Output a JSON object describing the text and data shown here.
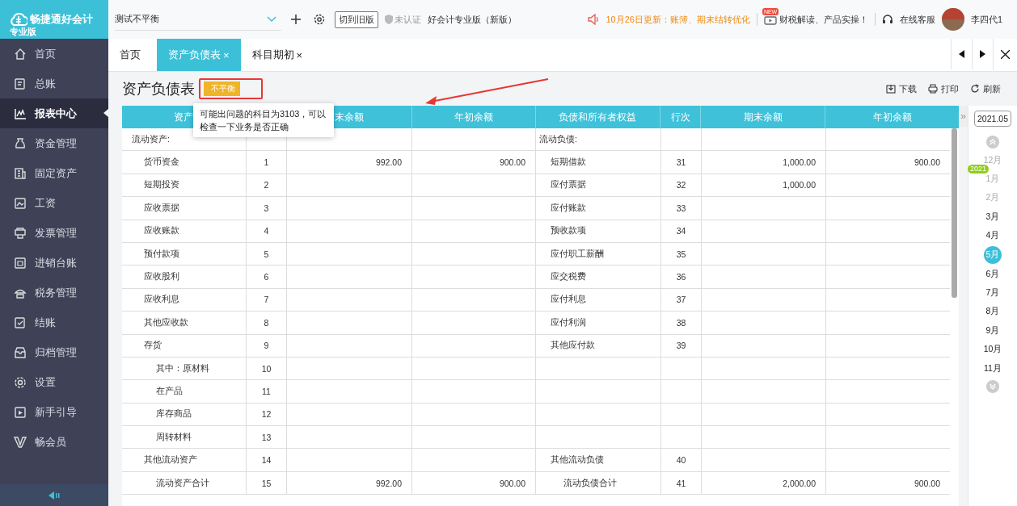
{
  "logo": {
    "name": "畅捷通好会计",
    "edition": "专业版"
  },
  "sidebar": {
    "items": [
      {
        "label": "首页",
        "selected": false
      },
      {
        "label": "总账",
        "selected": false
      },
      {
        "label": "报表中心",
        "selected": true
      },
      {
        "label": "资金管理",
        "selected": false
      },
      {
        "label": "固定资产",
        "selected": false
      },
      {
        "label": "工资",
        "selected": false
      },
      {
        "label": "发票管理",
        "selected": false
      },
      {
        "label": "进销台账",
        "selected": false
      },
      {
        "label": "税务管理",
        "selected": false
      },
      {
        "label": "结账",
        "selected": false
      },
      {
        "label": "归档管理",
        "selected": false
      },
      {
        "label": "设置",
        "selected": false
      },
      {
        "label": "新手引导",
        "selected": false
      },
      {
        "label": "畅会员",
        "selected": false
      }
    ]
  },
  "topbar": {
    "company": "测试不平衡",
    "switch_button": "切到旧版",
    "cert": "未认证",
    "product": "好会计专业版（新版）",
    "notice": "10月26日更新：账簿、期末结转优化",
    "new_badge": "NEW",
    "video": "财税解读、产品实操！",
    "service": "在线客服",
    "user": "李四代1"
  },
  "tabs": [
    {
      "label": "首页",
      "closable": false,
      "selected": false
    },
    {
      "label": "资产负债表",
      "closable": true,
      "selected": true
    },
    {
      "label": "科目期初",
      "closable": true,
      "selected": false
    }
  ],
  "tab_close": "×",
  "page": {
    "title": "资产负债表",
    "status": "不平衡",
    "tooltip": "可能出问题的科目为3103，可以检查一下业务是否正确",
    "actions": [
      "下载",
      "打印",
      "刷新"
    ]
  },
  "table": {
    "columns": [
      {
        "label": "资产"
      },
      {},
      {
        "label": "末余额"
      },
      {
        "label": "年初余额"
      },
      {
        "label": "负债和所有者权益"
      },
      {
        "label": "行次"
      },
      {
        "label": "期末余额"
      },
      {
        "label": "年初余额"
      }
    ],
    "rows": [
      {
        "left": {
          "kind": "section",
          "name": "流动资产:"
        },
        "right": {
          "kind": "section",
          "name": "流动负债:"
        }
      },
      {
        "left": {
          "kind": "item",
          "name": "货币资金",
          "no": "1",
          "end": "992.00",
          "begin": "900.00"
        },
        "right": {
          "kind": "item",
          "name": "短期借款",
          "no": "31",
          "end": "1,000.00",
          "begin": "900.00"
        }
      },
      {
        "left": {
          "kind": "item",
          "name": "短期投资",
          "no": "2"
        },
        "right": {
          "kind": "item",
          "name": "应付票据",
          "no": "32",
          "end": "1,000.00"
        }
      },
      {
        "left": {
          "kind": "item",
          "name": "应收票据",
          "no": "3"
        },
        "right": {
          "kind": "item",
          "name": "应付账款",
          "no": "33"
        }
      },
      {
        "left": {
          "kind": "item",
          "name": "应收账款",
          "no": "4"
        },
        "right": {
          "kind": "item",
          "name": "预收款项",
          "no": "34"
        }
      },
      {
        "left": {
          "kind": "item",
          "name": "预付款项",
          "no": "5"
        },
        "right": {
          "kind": "item",
          "name": "应付职工薪酬",
          "no": "35"
        }
      },
      {
        "left": {
          "kind": "item",
          "name": "应收股利",
          "no": "6"
        },
        "right": {
          "kind": "item",
          "name": "应交税费",
          "no": "36"
        }
      },
      {
        "left": {
          "kind": "item",
          "name": "应收利息",
          "no": "7"
        },
        "right": {
          "kind": "item",
          "name": "应付利息",
          "no": "37"
        }
      },
      {
        "left": {
          "kind": "item",
          "name": "其他应收款",
          "no": "8"
        },
        "right": {
          "kind": "item",
          "name": "应付利润",
          "no": "38"
        }
      },
      {
        "left": {
          "kind": "item",
          "name": "存货",
          "no": "9"
        },
        "right": {
          "kind": "item",
          "name": "其他应付款",
          "no": "39"
        }
      },
      {
        "left": {
          "kind": "sub",
          "name": "其中：原材料",
          "no": "10"
        },
        "right": {
          "kind": "empty"
        }
      },
      {
        "left": {
          "kind": "sub",
          "name": "在产品",
          "no": "11"
        },
        "right": {
          "kind": "empty"
        }
      },
      {
        "left": {
          "kind": "sub",
          "name": "库存商品",
          "no": "12"
        },
        "right": {
          "kind": "empty"
        }
      },
      {
        "left": {
          "kind": "sub",
          "name": "周转材料",
          "no": "13"
        },
        "right": {
          "kind": "empty"
        }
      },
      {
        "left": {
          "kind": "item",
          "name": "其他流动资产",
          "no": "14"
        },
        "right": {
          "kind": "item",
          "name": "其他流动负债",
          "no": "40"
        }
      },
      {
        "left": {
          "kind": "sub",
          "name": "流动资产合计",
          "no": "15",
          "end": "992.00",
          "begin": "900.00"
        },
        "right": {
          "kind": "sub",
          "name": "流动负债合计",
          "no": "41",
          "end": "2,000.00",
          "begin": "900.00"
        }
      }
    ]
  },
  "calendar": {
    "expand": "»",
    "period": "2021.05",
    "year_badge": "2021",
    "months": [
      {
        "label": "12月",
        "dimmed": true,
        "selected": false
      },
      {
        "label": "1月",
        "dimmed": true,
        "selected": false
      },
      {
        "label": "2月",
        "dimmed": true,
        "selected": false
      },
      {
        "label": "3月",
        "dimmed": false,
        "selected": false
      },
      {
        "label": "4月",
        "dimmed": false,
        "selected": false
      },
      {
        "label": "5月",
        "dimmed": false,
        "selected": true
      },
      {
        "label": "6月",
        "dimmed": false,
        "selected": false
      },
      {
        "label": "7月",
        "dimmed": false,
        "selected": false
      },
      {
        "label": "8月",
        "dimmed": false,
        "selected": false
      },
      {
        "label": "9月",
        "dimmed": false,
        "selected": false
      },
      {
        "label": "10月",
        "dimmed": false,
        "selected": false
      },
      {
        "label": "11月",
        "dimmed": false,
        "selected": false
      }
    ]
  }
}
